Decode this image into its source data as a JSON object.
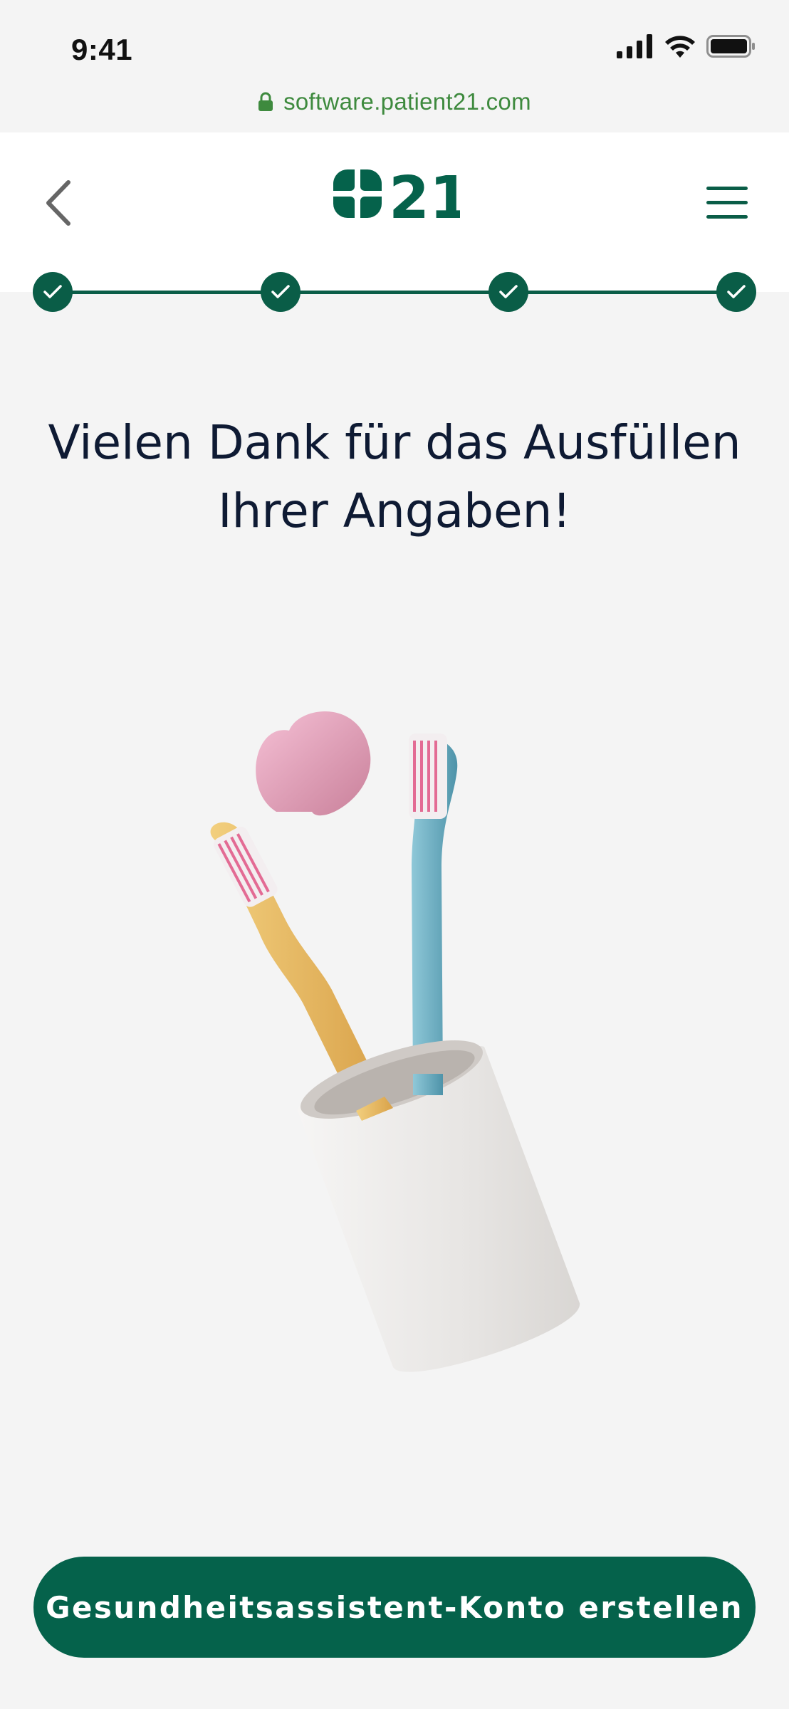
{
  "status_bar": {
    "time": "9:41",
    "icons": [
      "signal-icon",
      "wifi-icon",
      "battery-icon"
    ]
  },
  "browser": {
    "url": "software.patient21.com",
    "icon": "lock-icon"
  },
  "header": {
    "back_icon": "chevron-left-icon",
    "logo_text": "21",
    "menu_icon": "hamburger-icon"
  },
  "progress": {
    "steps_completed": 4,
    "steps_total": 4
  },
  "main": {
    "headline_line1": "Vielen Dank für das Ausfüllen",
    "headline_line2": "Ihrer Angaben!"
  },
  "cta": {
    "label": "Gesundheitsassistent-Konto erstellen"
  },
  "colors": {
    "brand_green": "#05624b",
    "url_green": "#3e8a3e",
    "background": "#f4f4f4",
    "headline": "#0e1a33"
  }
}
